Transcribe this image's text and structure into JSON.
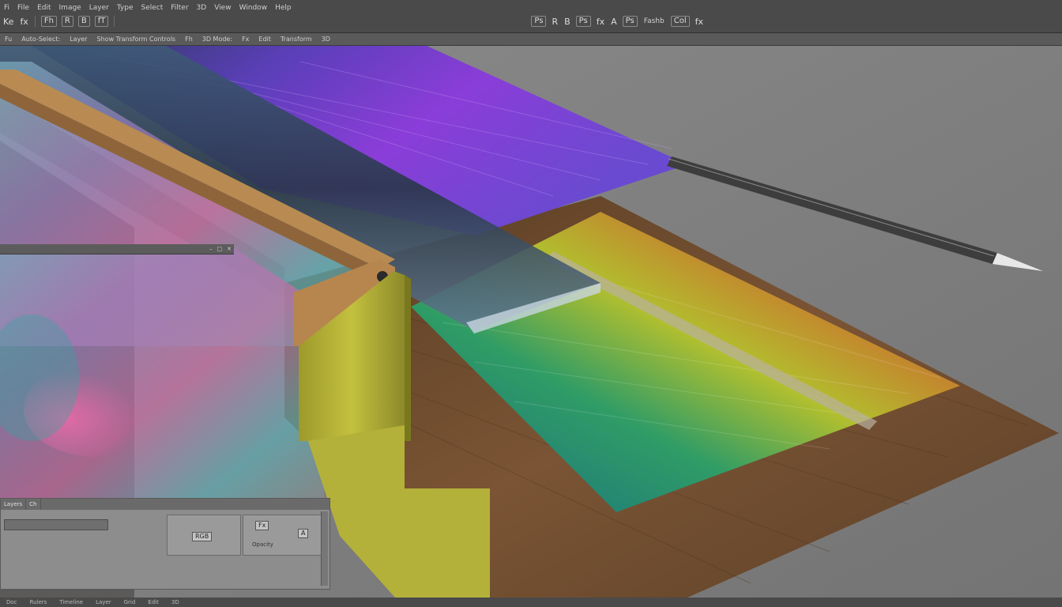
{
  "app": {
    "accent": "#4a4a4a"
  },
  "menubar": {
    "menus": [
      "Fi",
      "File",
      "Edit",
      "Image",
      "Layer",
      "Type",
      "Select",
      "Filter",
      "3D",
      "View",
      "Window",
      "Help"
    ],
    "tools_left": [
      "Ke",
      "fx",
      "Fh",
      "R",
      "B",
      "fT"
    ],
    "tools_right": [
      "Ps",
      "R",
      "B",
      "Ps",
      "fx",
      "A",
      "Ps",
      "Fashb",
      "Col",
      "fx"
    ]
  },
  "optbar": {
    "items": [
      "Fu",
      "Auto-Select:",
      "Layer",
      "Show Transform Controls",
      "Fh",
      "3D Mode:",
      "Fx",
      "Edit",
      "Transform",
      "3D"
    ]
  },
  "subwindow": {
    "buttons": [
      "–",
      "□",
      "✕"
    ]
  },
  "panel": {
    "tabs": [
      "Layers",
      "Ch"
    ],
    "buttons": [
      "RGB",
      "Fx",
      "A"
    ],
    "label": "Opacity"
  },
  "statusbar": {
    "items": [
      "Doc",
      "Rulers",
      "Timeline",
      "Layer",
      "Grid",
      "Edit",
      "3D"
    ]
  },
  "colors": {
    "wood": "#6b4a2e",
    "yellow": "#b9b53a",
    "purple": "#8a3dd8",
    "canvas_bg": "#7e7e7e"
  }
}
